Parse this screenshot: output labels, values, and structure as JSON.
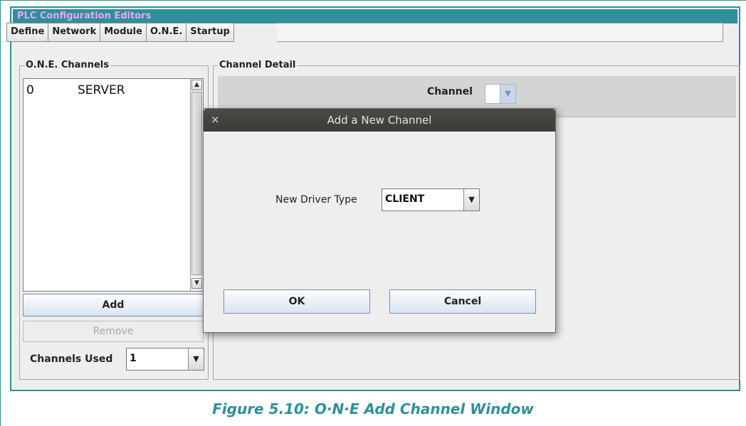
{
  "window": {
    "title": "PLC Configuration Editors",
    "tabs": [
      "Define",
      "Network",
      "Module",
      "O.N.E.",
      "Startup"
    ]
  },
  "channels_panel": {
    "title": "O.N.E. Channels",
    "items": [
      {
        "number": "0",
        "name": "SERVER"
      }
    ],
    "add_label": "Add",
    "remove_label": "Remove",
    "channels_used_label": "Channels Used",
    "channels_used_value": "1"
  },
  "detail_panel": {
    "title": "Channel Detail",
    "channel_label": "Channel",
    "channel_value": ""
  },
  "dialog": {
    "title": "Add a New Channel",
    "close_glyph": "×",
    "driver_type_label": "New Driver Type",
    "driver_type_value": "CLIENT",
    "ok_label": "OK",
    "cancel_label": "Cancel"
  },
  "caption": "Figure 5.10: O·N·E Add Channel Window",
  "colors": {
    "accent": "#2f8f9a",
    "title_text": "#e7a8ef"
  }
}
